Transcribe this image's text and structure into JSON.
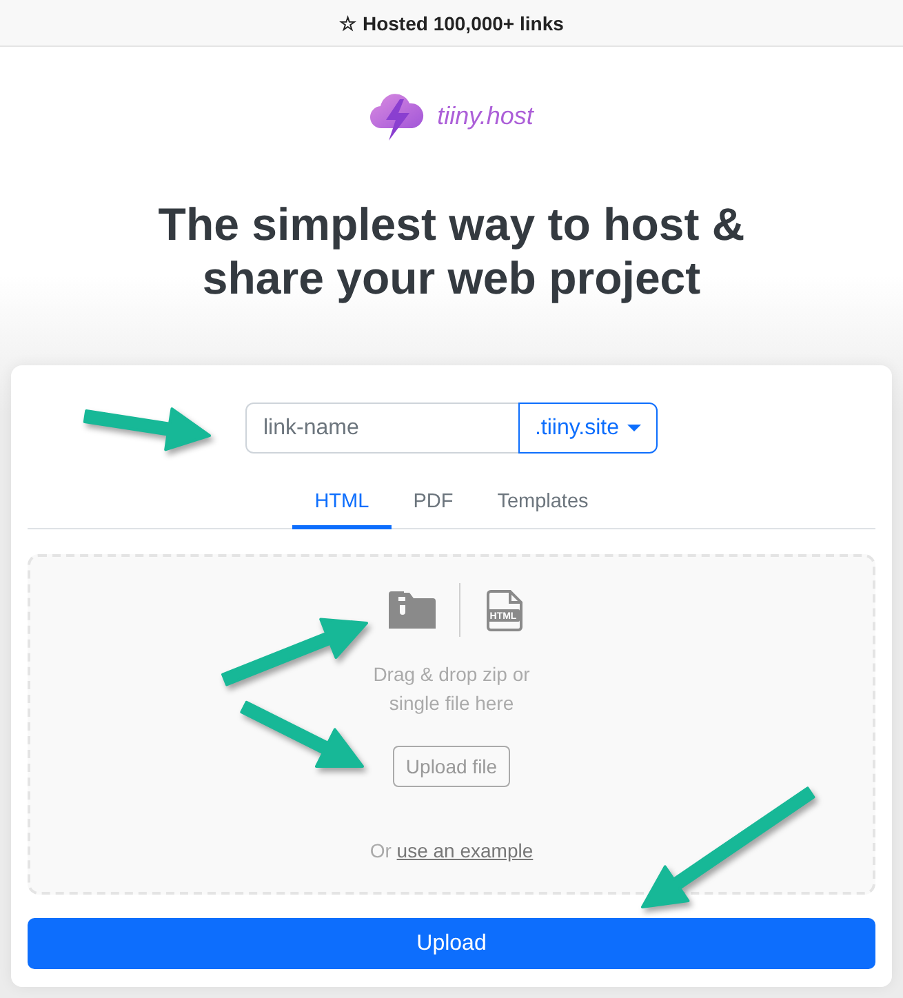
{
  "top_banner": {
    "text": "☆ Hosted 100,000+ links"
  },
  "logo": {
    "wordmark": "tiiny.host"
  },
  "headline": "The simplest way to host & share your web project",
  "link_form": {
    "placeholder": "link-name",
    "domain": ".tiiny.site"
  },
  "tabs": [
    {
      "label": "HTML",
      "selected": true
    },
    {
      "label": "PDF",
      "selected": false
    },
    {
      "label": "Templates",
      "selected": false
    }
  ],
  "dropzone": {
    "file_icon_label": "HTML",
    "instruction": "Drag & drop zip or single file here",
    "button": "Upload file",
    "example_prefix": "Or",
    "example_link": "use an example"
  },
  "upload_button": "Upload"
}
